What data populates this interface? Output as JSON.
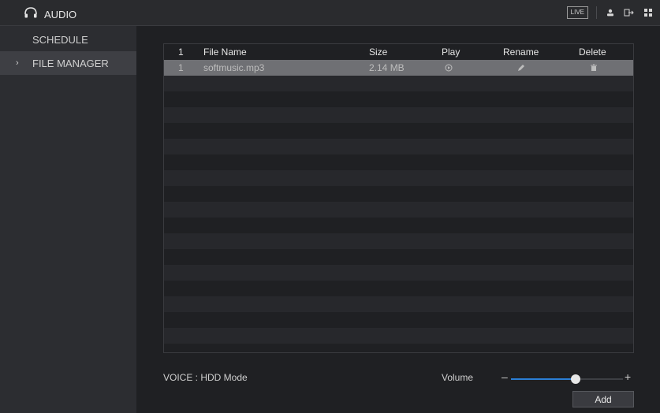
{
  "header": {
    "title": "AUDIO",
    "live_label": "LIVE",
    "icons": [
      "headphones-icon",
      "user-icon",
      "logout-icon",
      "grid-icon"
    ]
  },
  "sidebar": {
    "items": [
      {
        "label": "SCHEDULE"
      },
      {
        "label": "FILE MANAGER",
        "selected": true
      }
    ]
  },
  "table": {
    "headers": [
      "1",
      "File Name",
      "Size",
      "Play",
      "Rename",
      "Delete"
    ],
    "rows": [
      {
        "index": "1",
        "file_name": "softmusic.mp3",
        "size": "2.14 MB"
      }
    ]
  },
  "footer": {
    "voice_text": "VOICE : HDD Mode",
    "volume_label": "Volume",
    "volume_level": 0.58,
    "add_button": "Add"
  },
  "colors": {
    "accent": "#2b7fd6",
    "selected_row": "#6f7074"
  }
}
